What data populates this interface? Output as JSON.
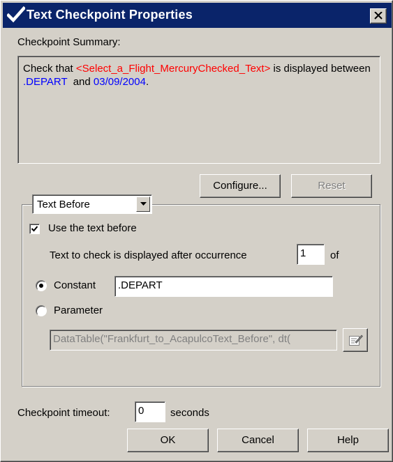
{
  "window": {
    "title": "Text Checkpoint Properties",
    "close_label": "close"
  },
  "summary": {
    "label": "Checkpoint Summary:",
    "prefix": "Check that ",
    "object_name": "<Select_a_Flight_MercuryChecked_Text>",
    "middle": " is  displayed between ",
    "before_value": ".DEPART",
    "and": "  and ",
    "after_value": "03/09/2004",
    "suffix": "."
  },
  "buttons": {
    "configure": "Configure...",
    "reset": "Reset",
    "ok": "OK",
    "cancel": "Cancel",
    "help": "Help"
  },
  "group": {
    "mode_selected": "Text Before",
    "use_text_label": "Use the text before",
    "use_text_checked": true,
    "occurrence_label": "Text to check is displayed after occurrence",
    "occurrence_value": "1",
    "occurrence_of": "of",
    "constant_label": "Constant",
    "constant_selected": true,
    "constant_value": ".DEPART",
    "parameter_label": "Parameter",
    "parameter_value": "DataTable(\"Frankfurt_to_AcapulcoText_Before\", dt("
  },
  "timeout": {
    "label": "Checkpoint timeout:",
    "value": "0",
    "unit": "seconds"
  },
  "colors": {
    "title_bar": "#0a246a",
    "object_name": "#ff0000",
    "values": "#0000ff"
  },
  "icons": {
    "title": "checkmark-icon",
    "close": "close-icon",
    "dropdown": "chevron-down-icon",
    "parameter_edit": "edit-parameter-icon"
  }
}
